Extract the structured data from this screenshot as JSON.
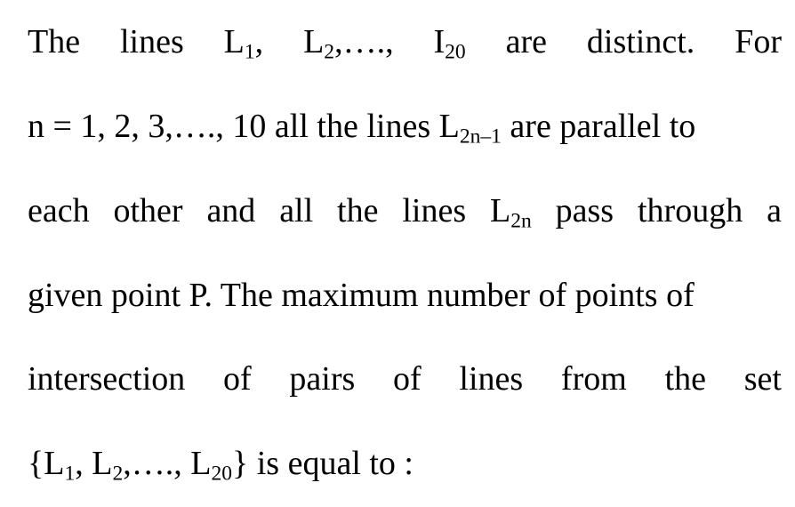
{
  "problem": {
    "line1": {
      "w1": "The",
      "w2": "lines",
      "w3a": "L",
      "w3sub": "1",
      "w3b": ",",
      "w4a": "L",
      "w4sub": "2",
      "w4b": ",….,",
      "w5a": "I",
      "w5sub": "20",
      "w6": "are",
      "w7": "distinct.",
      "w8": "For"
    },
    "line2": {
      "a": "n = 1, 2, 3,…., 10 all the lines L",
      "sub": "2n–1",
      "b": " are parallel to"
    },
    "line3": {
      "w1": "each",
      "w2": "other",
      "w3": "and",
      "w4": "all",
      "w5": "the",
      "w6": "lines",
      "w7a": "L",
      "w7sub": "2n",
      "w8": "pass",
      "w9": "through",
      "w10": "a"
    },
    "line4": {
      "text": "given point P. The maximum number of points of"
    },
    "line5": {
      "w1": "intersection",
      "w2": "of",
      "w3": "pairs",
      "w4": "of",
      "w5": "lines",
      "w6": "from",
      "w7": "the",
      "w8": "set"
    },
    "line6": {
      "a": "{L",
      "sub1": "1",
      "b": ", L",
      "sub2": "2",
      "c": ",…., L",
      "sub3": "20",
      "d": "} is equal to :"
    }
  }
}
